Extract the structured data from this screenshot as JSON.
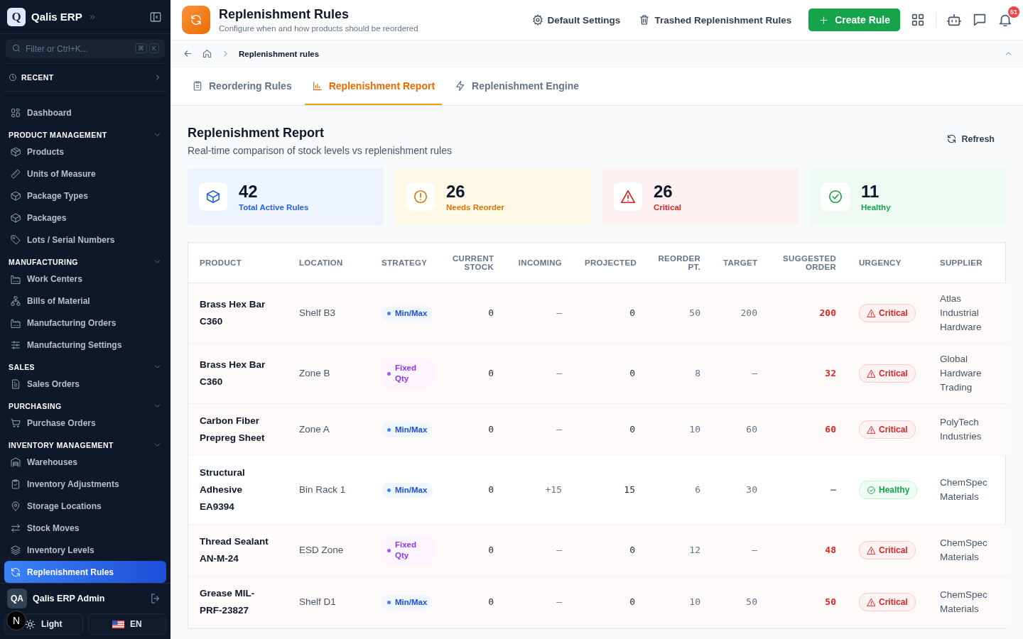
{
  "sidebar": {
    "logo_letter": "Q",
    "brand": "Qalis ERP",
    "search_placeholder": "Filter or Ctrl+K...",
    "shortcut_keys": [
      "⌘",
      "K"
    ],
    "recent": {
      "label": "RECENT"
    },
    "top_items": [
      {
        "label": "Dashboard",
        "selected": false
      }
    ],
    "sections": [
      {
        "title": "PRODUCT MANAGEMENT",
        "expanded": true,
        "items": [
          {
            "label": "Products",
            "selected": false
          },
          {
            "label": "Units of Measure",
            "selected": false
          },
          {
            "label": "Package Types",
            "selected": false
          },
          {
            "label": "Packages",
            "selected": false
          },
          {
            "label": "Lots / Serial Numbers",
            "selected": false
          }
        ]
      },
      {
        "title": "MANUFACTURING",
        "expanded": true,
        "items": [
          {
            "label": "Work Centers",
            "selected": false
          },
          {
            "label": "Bills of Material",
            "selected": false
          },
          {
            "label": "Manufacturing Orders",
            "selected": false
          },
          {
            "label": "Manufacturing Settings",
            "selected": false
          }
        ]
      },
      {
        "title": "SALES",
        "expanded": true,
        "items": [
          {
            "label": "Sales Orders",
            "selected": false
          }
        ]
      },
      {
        "title": "PURCHASING",
        "expanded": true,
        "items": [
          {
            "label": "Purchase Orders",
            "selected": false
          }
        ]
      },
      {
        "title": "INVENTORY MANAGEMENT",
        "expanded": true,
        "items": [
          {
            "label": "Warehouses",
            "selected": false
          },
          {
            "label": "Inventory Adjustments",
            "selected": false
          },
          {
            "label": "Storage Locations",
            "selected": false
          },
          {
            "label": "Stock Moves",
            "selected": false
          },
          {
            "label": "Inventory Levels",
            "selected": false
          },
          {
            "label": "Replenishment Rules",
            "selected": true
          }
        ]
      }
    ],
    "user": {
      "initials": "QA",
      "name": "Qalis ERP Admin"
    },
    "theme_button": "Light",
    "language_button": "EN",
    "dev_badge": "N"
  },
  "header": {
    "title": "Replenishment Rules",
    "subtitle": "Configure when and how products should be reordered",
    "actions": [
      "Default Settings",
      "Trashed Replenishment Rules"
    ],
    "primary_button": "Create Rule",
    "notification_count": "51"
  },
  "breadcrumb": {
    "current": "Replenishment rules"
  },
  "tabs": [
    {
      "label": "Reordering Rules",
      "selected": false
    },
    {
      "label": "Replenishment Report",
      "selected": true
    },
    {
      "label": "Replenishment Engine",
      "selected": false
    }
  ],
  "report": {
    "title": "Replenishment Report",
    "subtitle": "Real-time comparison of stock levels vs replenishment rules",
    "refresh_button": "Refresh"
  },
  "stats": [
    {
      "kind": "total",
      "value": "42",
      "label": "Total Active Rules"
    },
    {
      "kind": "warning",
      "value": "26",
      "label": "Needs Reorder"
    },
    {
      "kind": "critical",
      "value": "26",
      "label": "Critical"
    },
    {
      "kind": "healthy",
      "value": "11",
      "label": "Healthy"
    }
  ],
  "table": {
    "columns": [
      "PRODUCT",
      "LOCATION",
      "STRATEGY",
      "CURRENT STOCK",
      "INCOMING",
      "PROJECTED",
      "REORDER PT.",
      "TARGET",
      "SUGGESTED ORDER",
      "URGENCY",
      "SUPPLIER"
    ],
    "rows": [
      {
        "product": "Brass Hex Bar C360",
        "location": "Shelf B3",
        "strategy": {
          "kind": "min_max",
          "label": "Min/Max"
        },
        "current_stock": "0",
        "incoming": "–",
        "projected": "0",
        "reorder_point": "50",
        "target": "200",
        "suggested_order": "200",
        "urgency": {
          "kind": "critical",
          "label": "Critical"
        },
        "supplier": "Atlas Industrial Hardware"
      },
      {
        "product": "Brass Hex Bar C360",
        "location": "Zone B",
        "strategy": {
          "kind": "fixed_qty",
          "label": "Fixed Qty"
        },
        "current_stock": "0",
        "incoming": "–",
        "projected": "0",
        "reorder_point": "8",
        "target": "–",
        "suggested_order": "32",
        "urgency": {
          "kind": "critical",
          "label": "Critical"
        },
        "supplier": "Global Hardware Trading"
      },
      {
        "product": "Carbon Fiber Prepreg Sheet",
        "location": "Zone A",
        "strategy": {
          "kind": "min_max",
          "label": "Min/Max"
        },
        "current_stock": "0",
        "incoming": "–",
        "projected": "0",
        "reorder_point": "10",
        "target": "60",
        "suggested_order": "60",
        "urgency": {
          "kind": "critical",
          "label": "Critical"
        },
        "supplier": "PolyTech Industries"
      },
      {
        "product": "Structural Adhesive EA9394",
        "location": "Bin Rack 1",
        "strategy": {
          "kind": "min_max",
          "label": "Min/Max"
        },
        "current_stock": "0",
        "incoming": "+15",
        "projected": "15",
        "reorder_point": "6",
        "target": "30",
        "suggested_order": "–",
        "urgency": {
          "kind": "healthy",
          "label": "Healthy"
        },
        "supplier": "ChemSpec Materials"
      },
      {
        "product": "Thread Sealant AN-M-24",
        "location": "ESD Zone",
        "strategy": {
          "kind": "fixed_qty",
          "label": "Fixed Qty"
        },
        "current_stock": "0",
        "incoming": "–",
        "projected": "0",
        "reorder_point": "12",
        "target": "–",
        "suggested_order": "48",
        "urgency": {
          "kind": "critical",
          "label": "Critical"
        },
        "supplier": "ChemSpec Materials"
      },
      {
        "product": "Grease MIL-PRF-23827",
        "location": "Shelf D1",
        "strategy": {
          "kind": "min_max",
          "label": "Min/Max"
        },
        "current_stock": "0",
        "incoming": "–",
        "projected": "0",
        "reorder_point": "10",
        "target": "50",
        "suggested_order": "50",
        "urgency": {
          "kind": "critical",
          "label": "Critical"
        },
        "supplier": "ChemSpec Materials"
      }
    ]
  }
}
